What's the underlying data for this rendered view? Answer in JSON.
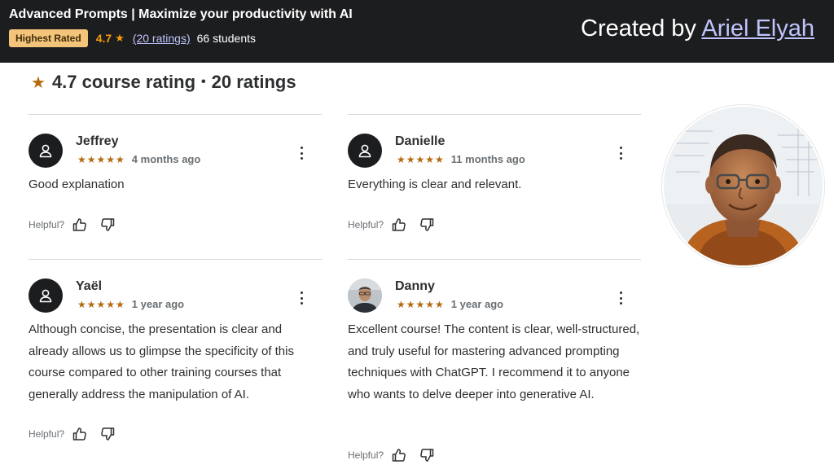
{
  "header": {
    "course_title": "Advanced Prompts | Maximize your productivity with AI",
    "badge": "Highest Rated",
    "rating": "4.7",
    "ratings_count": "(20 ratings)",
    "students": "66 students",
    "created_by_prefix": "Created by",
    "author": "Ariel Elyah"
  },
  "summary": {
    "rating_text": "4.7 course rating",
    "separator": "•",
    "ratings_text": "20 ratings"
  },
  "reviews": [
    {
      "name": "Jeffrey",
      "stars": "★★★★★",
      "rating": 5,
      "date": "4 months ago",
      "text": "Good explanation",
      "helpful_label": "Helpful?"
    },
    {
      "name": "Danielle",
      "stars": "★★★★★",
      "rating": 5,
      "date": "11 months ago",
      "text": "Everything is clear and relevant.",
      "helpful_label": "Helpful?"
    },
    {
      "name": "Yaël",
      "stars": "★★★★★",
      "rating": 5,
      "date": "1 year ago",
      "text": "Although concise, the presentation is clear and already allows us to glimpse the specificity of this course compared to other training courses that generally address the manipulation of AI.",
      "helpful_label": "Helpful?"
    },
    {
      "name": "Danny",
      "stars": "★★★★★",
      "rating": 5,
      "date": "1 year ago",
      "text": "Excellent course! The content is clear, well-structured, and truly useful for mastering advanced prompting techniques with ChatGPT. I recommend it to anyone who wants to delve deeper into generative AI.",
      "helpful_label": "Helpful?"
    }
  ],
  "colors": {
    "header_bg": "#1c1d1f",
    "badge_bg": "#f4c47b",
    "star": "#b4690e",
    "link": "#c0c4fc"
  },
  "icons": {
    "star": "star-icon",
    "user": "user-icon",
    "thumbs_up": "thumbs-up-icon",
    "thumbs_down": "thumbs-down-icon",
    "more": "more-vertical-icon"
  }
}
